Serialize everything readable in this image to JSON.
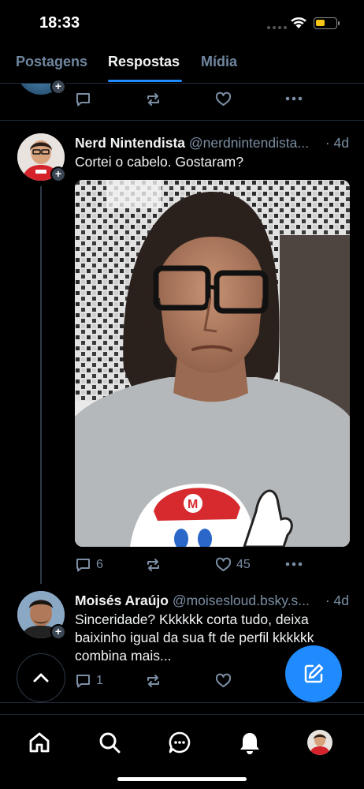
{
  "status_bar": {
    "time": "18:33",
    "icons": [
      "signal-icon",
      "wifi-icon",
      "battery-icon"
    ],
    "battery_color": "#f5c518"
  },
  "tabs": [
    {
      "label": "Postagens",
      "active": false
    },
    {
      "label": "Respostas",
      "active": true
    },
    {
      "label": "Mídia",
      "active": false
    }
  ],
  "accent_color": "#208bfe",
  "previous_post": {
    "actions": [
      "reply-icon",
      "repost-icon",
      "like-icon",
      "more-icon"
    ]
  },
  "posts": [
    {
      "display_name": "Nerd Nintendista",
      "handle": "@nerdnintendista...",
      "time": "· 4d",
      "text": "Cortei o cabelo. Gostaram?",
      "has_image": true,
      "replies": "6",
      "likes": "45"
    },
    {
      "display_name": "Moisés Araújo",
      "handle": "@moisesloud.bsky.s...",
      "time": "· 4d",
      "text": "Sinceridade? Kkkkkk corta tudo, deixa baixinho igual da sua ft de perfil kkkkkk combina mais...",
      "has_image": false,
      "replies": "1",
      "likes": ""
    }
  ],
  "bottom_nav": [
    "home-icon",
    "search-icon",
    "chat-icon",
    "notifications-icon",
    "profile-avatar"
  ]
}
